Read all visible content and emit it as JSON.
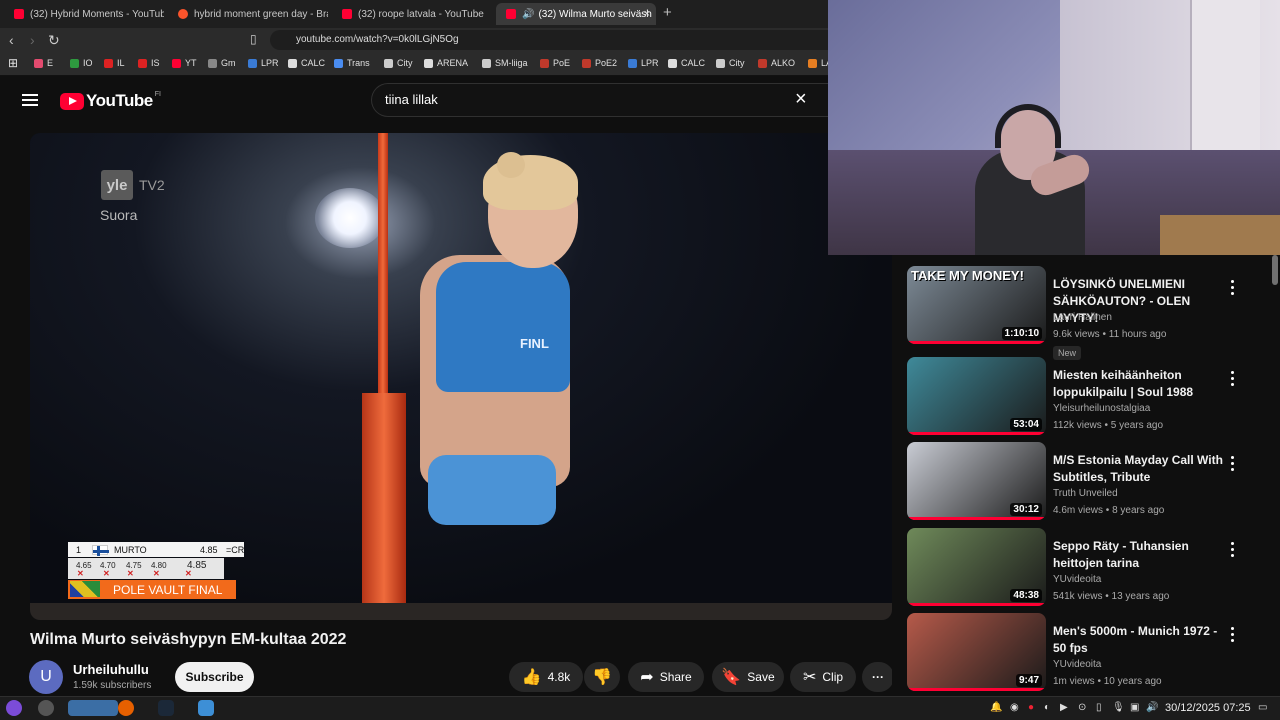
{
  "tabs": [
    {
      "label": "(32) Hybrid Moments - YouTube",
      "active": false
    },
    {
      "label": "hybrid moment green day - Bra",
      "active": false
    },
    {
      "label": "(32) roope latvala - YouTube",
      "active": false
    },
    {
      "label": "(32) Wilma Murto seiväsh",
      "active": true
    }
  ],
  "tab_close": "×",
  "new_tab": "+",
  "address": {
    "url": "youtube.com/watch?v=0k0lLGjN5Og"
  },
  "bookmarks": [
    {
      "label": "E",
      "color": "#e34b6f"
    },
    {
      "label": "IO",
      "color": "#2e9a3f"
    },
    {
      "label": "IL",
      "color": "#d22"
    },
    {
      "label": "IS",
      "color": "#d22"
    },
    {
      "label": "YT",
      "color": "#ff0033"
    },
    {
      "label": "Gm",
      "color": "#888"
    },
    {
      "label": "LPR",
      "color": "#3a7bd5"
    },
    {
      "label": "CALC",
      "color": "#ddd"
    },
    {
      "label": "Trans",
      "color": "#4a8cf0"
    },
    {
      "label": "City",
      "color": "#ccc"
    },
    {
      "label": "ARENA",
      "color": "#ddd"
    },
    {
      "label": "SM-liiga",
      "color": "#ccc"
    },
    {
      "label": "PoE",
      "color": "#c0392b"
    },
    {
      "label": "PoE2",
      "color": "#c0392b"
    },
    {
      "label": "LPR",
      "color": "#3a7bd5"
    },
    {
      "label": "CALC",
      "color": "#ddd"
    },
    {
      "label": "City",
      "color": "#ccc"
    },
    {
      "label": "ALKO",
      "color": "#c0392b"
    },
    {
      "label": "LA",
      "color": "#e67e22"
    }
  ],
  "youtube": {
    "logo_text": "YouTube",
    "country": "FI",
    "search_value": "tiina lillak",
    "clear_icon": "×"
  },
  "video": {
    "broadcaster": "yle",
    "channel_tag": "TV2",
    "live_label": "Suora",
    "shirt_text": "FINL",
    "scoreboard": {
      "rank": "1",
      "athlete": "MURTO",
      "result": "4.85",
      "record": "=CR",
      "attempts": [
        "4.65",
        "4.70",
        "4.75",
        "4.80",
        "4.85"
      ],
      "event": "POLE VAULT FINAL"
    },
    "title": "Wilma Murto seiväshypyn EM-kultaa 2022",
    "channel": "Urheiluhullu",
    "avatar_letter": "U",
    "subscribers": "1.59k subscribers",
    "subscribe_label": "Subscribe",
    "likes": "4.8k",
    "share_label": "Share",
    "save_label": "Save",
    "clip_label": "Clip",
    "more_label": "···"
  },
  "recommendations": [
    {
      "title": "LÖYSINKÖ UNELMIENI SÄHKÖAUTON? - OLEN MYYTY!",
      "channel": "Lauri Halinen",
      "views": "9.6k views",
      "age": "11 hours ago",
      "duration": "1:10:10",
      "badge": "New",
      "thumb_text": "TAKE MY MONEY!",
      "thumb_color": "#7d8a96"
    },
    {
      "title": "Miesten keihäänheiton loppukilpailu | Soul 1988",
      "channel": "Yleisurheilunostalgiaa",
      "views": "112k views",
      "age": "5 years ago",
      "duration": "53:04",
      "badge": "",
      "thumb_text": "",
      "thumb_color": "#3f8a9a"
    },
    {
      "title": "M/S Estonia Mayday Call With Subtitles, Tribute",
      "channel": "Truth Unveiled",
      "views": "4.6m views",
      "age": "8 years ago",
      "duration": "30:12",
      "badge": "",
      "thumb_text": "",
      "thumb_color": "#c9ccd4"
    },
    {
      "title": "Seppo Räty - Tuhansien heittojen tarina",
      "channel": "YUvideoita",
      "views": "541k views",
      "age": "13 years ago",
      "duration": "48:38",
      "badge": "",
      "thumb_text": "",
      "thumb_color": "#6f8a5a"
    },
    {
      "title": "Men's 5000m - Munich 1972 - 50 fps",
      "channel": "YUvideoita",
      "views": "1m views",
      "age": "10 years ago",
      "duration": "9:47",
      "badge": "",
      "thumb_text": "",
      "thumb_color": "#b65a4a"
    }
  ],
  "taskbar": {
    "clock": "30/12/2025 07:25"
  }
}
